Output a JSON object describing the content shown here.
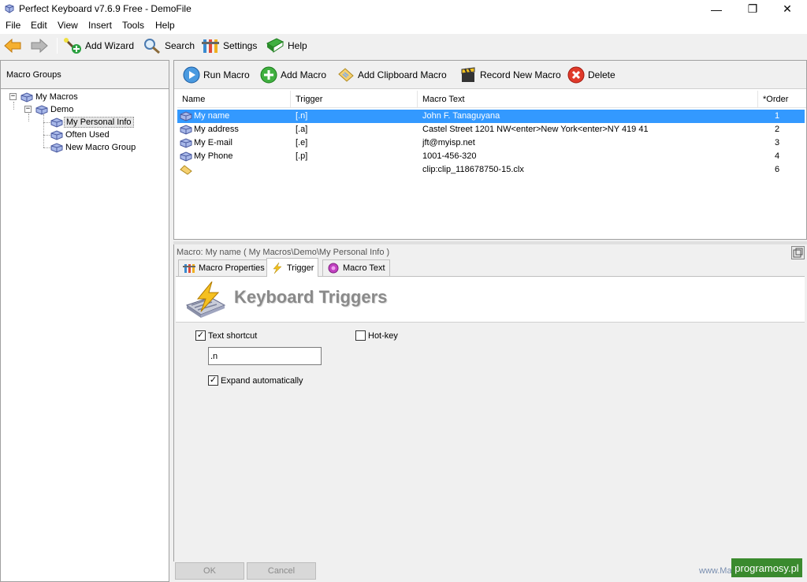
{
  "window": {
    "title": "Perfect Keyboard v7.6.9 Free - DemoFile",
    "minimize": "—",
    "maximize": "❐",
    "close": "✕"
  },
  "menu": [
    "File",
    "Edit",
    "View",
    "Insert",
    "Tools",
    "Help"
  ],
  "toolbar": {
    "back_icon": "arrow-left-icon",
    "forward_icon": "arrow-right-icon",
    "add_wizard": "Add Wizard",
    "search": "Search",
    "settings": "Settings",
    "help": "Help"
  },
  "left_pane": {
    "header": "Macro Groups",
    "tree": {
      "root": "My Macros",
      "child": "Demo",
      "groups": [
        "My Personal Info",
        "Often Used",
        "New Macro Group"
      ],
      "selected": "My Personal Info"
    }
  },
  "macro_toolbar": {
    "run": "Run Macro",
    "add": "Add Macro",
    "add_clipboard": "Add Clipboard Macro",
    "record": "Record New Macro",
    "delete": "Delete"
  },
  "macro_list": {
    "columns": [
      "Name",
      "Trigger",
      "Macro Text",
      "*Order"
    ],
    "rows": [
      {
        "name": "My name",
        "trigger": "[.n]",
        "text": "John F. Tanaguyana",
        "order": "1",
        "icon": "macro-icon",
        "selected": true
      },
      {
        "name": "My address",
        "trigger": "[.a]",
        "text": "Castel Street 1201 NW<enter>New York<enter>NY 419 41",
        "order": "2",
        "icon": "macro-icon"
      },
      {
        "name": "My E-mail",
        "trigger": "[.e]",
        "text": "jft@myisp.net",
        "order": "3",
        "icon": "macro-icon"
      },
      {
        "name": "My Phone",
        "trigger": "[.p]",
        "text": "1001-456-320",
        "order": "4",
        "icon": "macro-icon"
      },
      {
        "name": "",
        "trigger": "",
        "text": "clip:clip_118678750-15.clx",
        "order": "6",
        "icon": "clipboard-macro-icon"
      }
    ]
  },
  "details": {
    "path": "Macro: My name ( My Macros\\Demo\\My Personal Info )",
    "tabs": [
      "Macro Properties",
      "Trigger",
      "Macro Text"
    ],
    "active_tab": "Trigger",
    "banner_title": "Keyboard Triggers",
    "text_shortcut_label": "Text shortcut",
    "text_shortcut_checked": true,
    "hotkey_label": "Hot-key",
    "hotkey_checked": false,
    "shortcut_value": ".n",
    "expand_label": "Expand automatically",
    "expand_checked": true
  },
  "dialog_buttons": {
    "ok": "OK",
    "cancel": "Cancel"
  },
  "footer_link": "www.Ma",
  "watermark": "programosy.pl",
  "colors": {
    "selection": "#3399ff",
    "watermark_bg": "#3a8a2e"
  }
}
